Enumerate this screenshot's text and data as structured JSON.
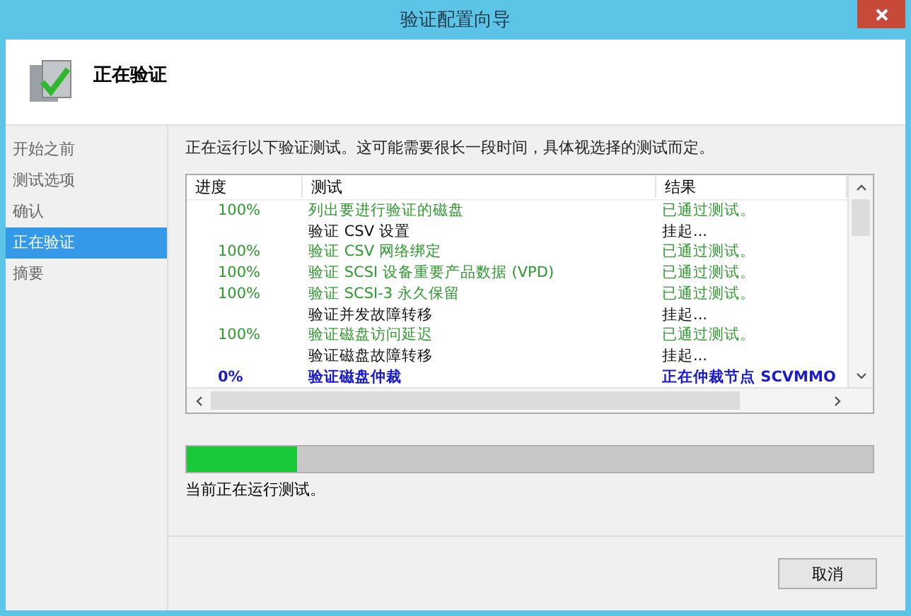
{
  "window": {
    "title": "验证配置向导"
  },
  "header": {
    "title": "正在验证"
  },
  "sidebar": {
    "items": [
      {
        "label": "开始之前",
        "selected": false
      },
      {
        "label": "测试选项",
        "selected": false
      },
      {
        "label": "确认",
        "selected": false
      },
      {
        "label": "正在验证",
        "selected": true
      },
      {
        "label": "摘要",
        "selected": false
      }
    ]
  },
  "intro": "正在运行以下验证测试。这可能需要很长一段时间，具体视选择的测试而定。",
  "table": {
    "columns": [
      "进度",
      "测试",
      "结果"
    ],
    "rows": [
      {
        "kind": "passed",
        "progress": "100%",
        "test": "列出要进行验证的磁盘",
        "result": "已通过测试。"
      },
      {
        "kind": "pending",
        "test": "验证 CSV 设置",
        "result": "挂起..."
      },
      {
        "kind": "passed",
        "progress": "100%",
        "test": "验证 CSV 网络绑定",
        "result": "已通过测试。"
      },
      {
        "kind": "passed",
        "progress": "100%",
        "test": "验证 SCSI 设备重要产品数据 (VPD)",
        "result": "已通过测试。"
      },
      {
        "kind": "passed",
        "progress": "100%",
        "test": "验证 SCSI-3 永久保留",
        "result": "已通过测试。"
      },
      {
        "kind": "pending",
        "test": "验证并发故障转移",
        "result": "挂起..."
      },
      {
        "kind": "passed",
        "progress": "100%",
        "test": "验证磁盘访问延迟",
        "result": "已通过测试。"
      },
      {
        "kind": "pending",
        "test": "验证磁盘故障转移",
        "result": "挂起..."
      },
      {
        "kind": "running",
        "progress": "0%",
        "test": "验证磁盘仲裁",
        "result": "正在仲裁节点 SCVMMO"
      }
    ]
  },
  "progress": {
    "level": 0.16
  },
  "status": "当前正在运行测试。",
  "buttons": [
    {
      "label": "取消"
    }
  ]
}
